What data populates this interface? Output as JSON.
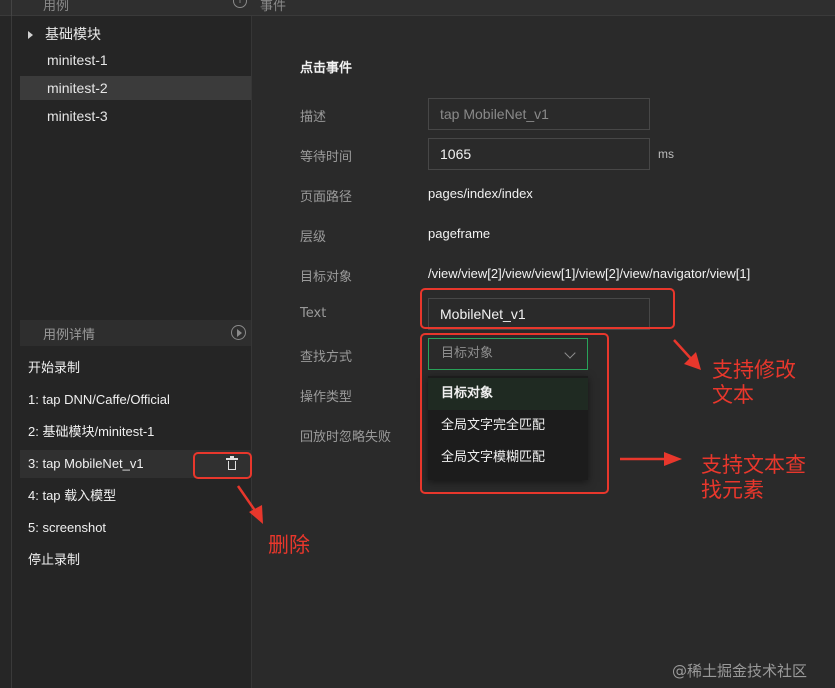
{
  "topbar": {
    "left_title": "用例",
    "right_title": "事件"
  },
  "tree": {
    "folder": "基础模块",
    "items": [
      "minitest-1",
      "minitest-2",
      "minitest-3"
    ],
    "selected_index": 1
  },
  "details": {
    "title": "用例详情",
    "steps": [
      "开始录制",
      "1: tap DNN/Caffe/Official",
      "2: 基础模块/minitest-1",
      "3: tap MobileNet_v1",
      "4: tap 载入模型",
      "5: screenshot",
      "停止录制"
    ]
  },
  "event": {
    "section_title": "点击事件",
    "labels": {
      "desc": "描述",
      "wait": "等待时间",
      "path": "页面路径",
      "level": "层级",
      "target": "目标对象",
      "text": "Text",
      "find": "查找方式",
      "op": "操作类型",
      "ignore": "回放时忽略失败"
    },
    "desc_placeholder": "tap MobileNet_v1",
    "wait_value": "1065",
    "wait_unit": "ms",
    "path_value": "pages/index/index",
    "level_value": "pageframe",
    "target_value": "/view/view[2]/view/view[1]/view[2]/view/navigator/view[1]",
    "text_value": "MobileNet_v1",
    "find_selected": "目标对象",
    "find_options": [
      "目标对象",
      "全局文字完全匹配",
      "全局文字模糊匹配"
    ]
  },
  "annotations": {
    "edit_text": [
      "支持修改",
      "文本"
    ],
    "find_text": [
      "支持文本查",
      "找元素"
    ],
    "delete": "删除",
    "color": "#e8372c"
  },
  "watermark": "@稀土掘金技术社区",
  "colors": {
    "accent_green": "#29a35a",
    "annotation_red": "#e8372c"
  }
}
